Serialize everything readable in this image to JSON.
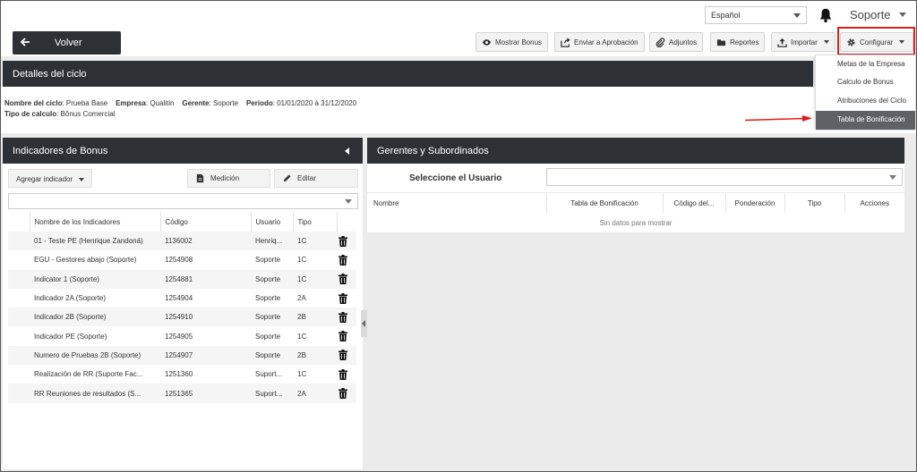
{
  "topbar": {
    "language": "Español",
    "user": "Soporte"
  },
  "toolbar": {
    "back_label": "Volver",
    "buttons": {
      "show_bonus": "Mostrar Bonus",
      "send_approval": "Enviar a Aprobación",
      "attachments": "Adjuntos",
      "reports": "Reportes",
      "import": "Importar",
      "configure": "Configurar"
    }
  },
  "cycle": {
    "header": "Detalles del ciclo",
    "name_label": "Nombre del ciclo",
    "name_value": "Prueba Base",
    "company_label": "Empresa",
    "company_value": "Qualitin",
    "manager_label": "Gerente",
    "manager_value": "Soporte",
    "period_label": "Periodo",
    "period_value": "01/01/2020 à 31/12/2020",
    "calc_label": "Tipo de calculo",
    "calc_value": "Bônus Comercial"
  },
  "config_menu": {
    "items": [
      {
        "label": "Metas de la Empresa"
      },
      {
        "label": "Calculo de Bonus"
      },
      {
        "label": "Atribuciones del Ciclo"
      },
      {
        "label": "Tabla de Bonificación"
      }
    ],
    "active_index": 3
  },
  "indicators": {
    "header": "Indicadores de Bonus",
    "add_label": "Agregar indicador",
    "measure_label": "Medición",
    "edit_label": "Editar",
    "columns": [
      "Nombre de los Indicadores",
      "Código",
      "Usuario",
      "Tipo"
    ],
    "rows": [
      {
        "name": "01 - Teste PE (Henrique Zandoná)",
        "code": "1136002",
        "user": "Henriq...",
        "type": "1C"
      },
      {
        "name": "EGU - Gestores abajo (Soporte)",
        "code": "1254908",
        "user": "Soporte",
        "type": "1C"
      },
      {
        "name": "Indicator 1 (Soporte)",
        "code": "1254881",
        "user": "Soporte",
        "type": "1C"
      },
      {
        "name": "Indicador 2A (Soporte)",
        "code": "1254904",
        "user": "Soporte",
        "type": "2A"
      },
      {
        "name": "Indicador 2B (Soporte)",
        "code": "1254910",
        "user": "Soporte",
        "type": "2B"
      },
      {
        "name": "Indicador PE (Soporte)",
        "code": "1254905",
        "user": "Soporte",
        "type": "1C"
      },
      {
        "name": "Numero de Pruebas 2B (Soporte)",
        "code": "1254907",
        "user": "Soporte",
        "type": "2B"
      },
      {
        "name": "Realización de RR (Suporte Fac...",
        "code": "1251360",
        "user": "Suport...",
        "type": "1C"
      },
      {
        "name": "RR Reuniones de resultados (S...",
        "code": "1251365",
        "user": "Suport...",
        "type": "2A"
      }
    ]
  },
  "managers": {
    "header": "Gerentes y Subordinados",
    "select_label": "Seleccione el Usuario",
    "columns": [
      "Nombre",
      "Tabla de Bonificación",
      "Código del...",
      "Ponderación",
      "Tipo",
      "Acciones"
    ],
    "empty_text": "Sin datos para mostrar"
  },
  "colors": {
    "header_dark": "#2d3136",
    "highlight_red": "#e21b1b",
    "menu_active": "#5e6166"
  }
}
